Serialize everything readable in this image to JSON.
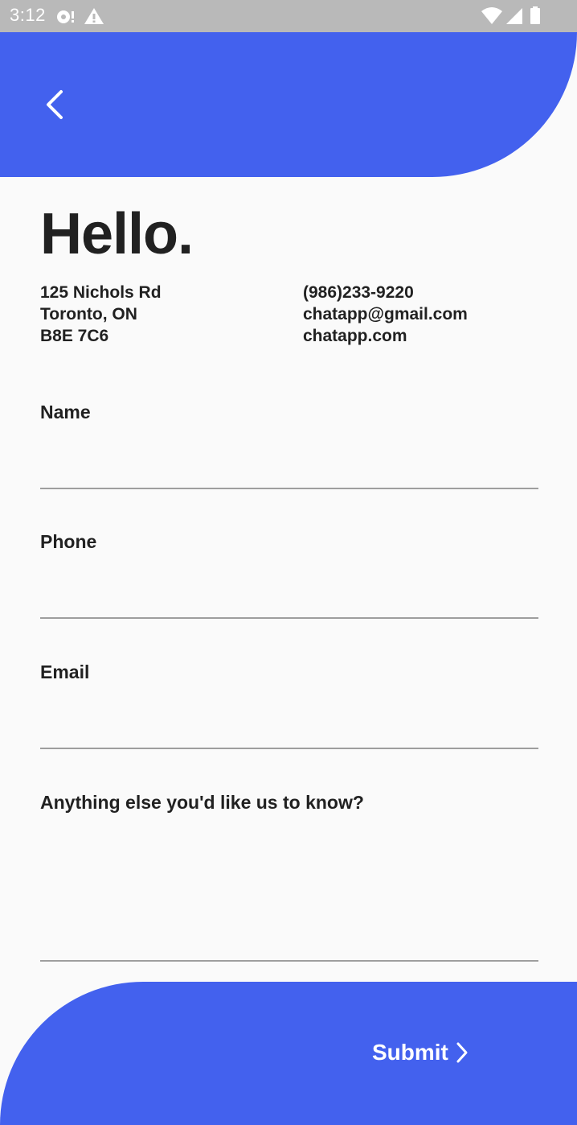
{
  "status_bar": {
    "time": "3:12"
  },
  "header": {
    "back_icon": "chevron-left-icon"
  },
  "greeting": "Hello.",
  "contact": {
    "address_line1": "125 Nichols Rd",
    "address_line2": "Toronto, ON",
    "address_line3": "B8E 7C6",
    "phone": "(986)233-9220",
    "email": "chatapp@gmail.com",
    "website": "chatapp.com"
  },
  "form": {
    "name_label": "Name",
    "name_value": "",
    "phone_label": "Phone",
    "phone_value": "",
    "email_label": "Email",
    "email_value": "",
    "message_label": "Anything else you'd like us to know?",
    "message_value": ""
  },
  "footer": {
    "submit_label": "Submit",
    "submit_icon": "chevron-right-icon"
  },
  "colors": {
    "accent": "#4361ee",
    "background": "#fafafa",
    "text": "#212121",
    "status_bar": "#b9b9b9"
  }
}
